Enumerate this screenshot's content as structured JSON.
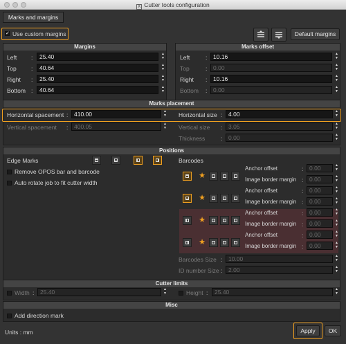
{
  "window": {
    "title": "Cutter tools configuration"
  },
  "tabs": [
    "Marks and margins"
  ],
  "use_custom_margins": {
    "label": "Use custom margins",
    "checked": true
  },
  "default_margins_label": "Default margins",
  "margins": {
    "header": "Margins",
    "rows": [
      {
        "label": "Left",
        "value": "25.40"
      },
      {
        "label": "Top",
        "value": "40.64"
      },
      {
        "label": "Right",
        "value": "25.40"
      },
      {
        "label": "Bottom",
        "value": "40.64"
      }
    ]
  },
  "marks_offset": {
    "header": "Marks offset",
    "rows": [
      {
        "label": "Left",
        "value": "10.16"
      },
      {
        "label": "Top",
        "value": "0.00"
      },
      {
        "label": "Right",
        "value": "10.16"
      },
      {
        "label": "Bottom",
        "value": "0.00"
      }
    ]
  },
  "marks_placement": {
    "header": "Marks placement",
    "horizontal_spacement": {
      "label": "Horizontal spacement",
      "value": "410.00"
    },
    "vertical_spacement": {
      "label": "Vertical spacement",
      "value": "400.05"
    },
    "horizontal_size": {
      "label": "Horizontal size",
      "value": "4.00"
    },
    "vertical_size": {
      "label": "Vertical size",
      "value": "3.05"
    },
    "thickness": {
      "label": "Thickness",
      "value": "0.00"
    }
  },
  "positions": {
    "header": "Positions",
    "edge_marks_label": "Edge Marks",
    "remove_opos": "Remove OPOS bar and barcode",
    "auto_rotate": "Auto rotate job to fit cutter width",
    "barcodes_label": "Barcodes",
    "barcode_rows": [
      {
        "anchor_offset": "0.00",
        "image_border_margin": "0.00"
      },
      {
        "anchor_offset": "0.00",
        "image_border_margin": "0.00"
      },
      {
        "anchor_offset": "0.00",
        "image_border_margin": "0.00"
      },
      {
        "anchor_offset": "0.00",
        "image_border_margin": "0.00"
      }
    ],
    "anchor_offset_label": "Anchor offset",
    "image_border_margin_label": "Image border margin",
    "barcodes_size": {
      "label": "Barcodes Size",
      "value": "10.00"
    },
    "id_number_size": {
      "label": "ID number Size",
      "value": "2.00"
    }
  },
  "cutter_limits": {
    "header": "Cutter limits",
    "width": {
      "label": "Width",
      "value": "25.40"
    },
    "height": {
      "label": "Height",
      "value": "25.40"
    }
  },
  "misc": {
    "header": "Misc",
    "add_direction_mark": "Add direction mark"
  },
  "footer": {
    "units": "Units :  mm",
    "apply": "Apply",
    "ok": "OK"
  },
  "colors": {
    "accent": "#f0a020",
    "background": "#333333",
    "field": "#161616"
  }
}
